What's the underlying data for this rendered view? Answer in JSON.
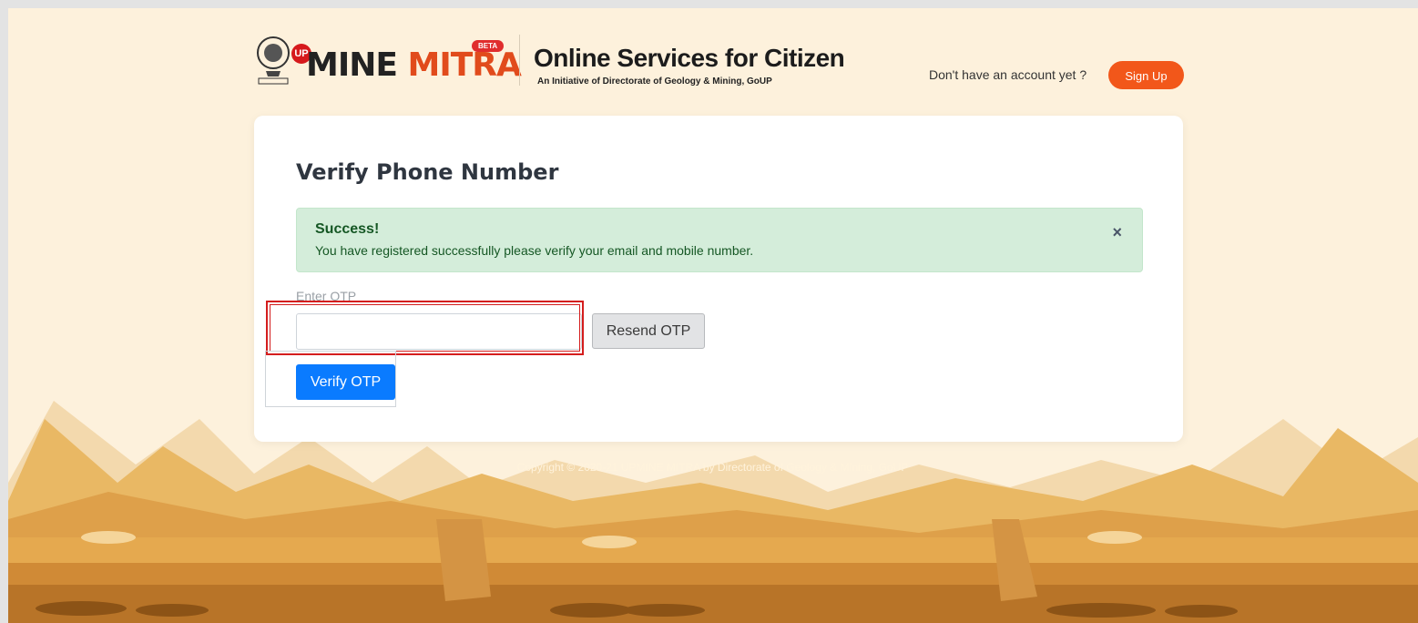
{
  "header": {
    "logo_badge": "UP",
    "logo_word_1": "MINE",
    "logo_word_2": "MITRA",
    "beta_badge": "BETA",
    "tagline_title": "Online Services for Citizen",
    "tagline_sub": "An Initiative of Directorate of Geology & Mining, GoUP",
    "account_prompt": "Don't have an account yet ?",
    "signup_label": "Sign Up"
  },
  "card": {
    "title": "Verify Phone Number",
    "alert": {
      "heading": "Success!",
      "message": "You have registered successfully please verify your email and mobile number.",
      "close_glyph": "×"
    },
    "otp_label": "Enter OTP",
    "otp_value": "",
    "resend_label": "Resend OTP",
    "verify_label": "Verify OTP"
  },
  "footer": {
    "copyright": "Copyright © 2020-21 UPMINE MITRA by Directorate of Geology & Mining, GoUP"
  },
  "colors": {
    "accent": "#f2571a",
    "primary_button": "#0a7bff",
    "success_bg": "#d4edda",
    "success_text": "#155724",
    "highlight": "#d41d1d",
    "background": "#fdf1dc"
  },
  "icons": {
    "emblem": "state-emblem-icon",
    "close": "close-icon"
  }
}
